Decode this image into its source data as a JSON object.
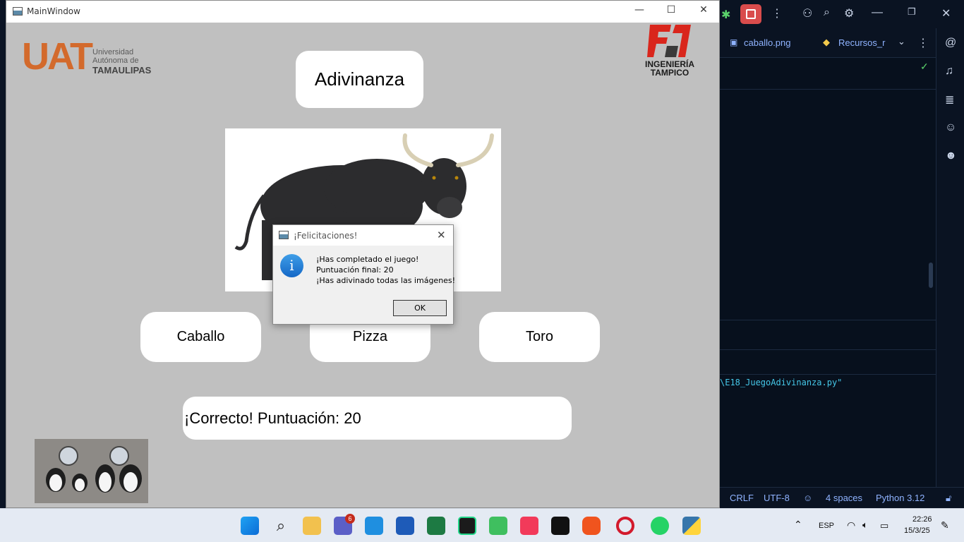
{
  "window": {
    "title": "MainWindow",
    "controls": {
      "minimize": "—",
      "maximize": "☐",
      "close": "✕"
    }
  },
  "logos": {
    "uat": {
      "mark": "UAT",
      "line1": "Universidad",
      "line2": "Autónoma de",
      "line3": "TAMAULIPAS"
    },
    "fi": {
      "line1": "INGENIERÍA",
      "line2": "TAMPICO"
    }
  },
  "game": {
    "heading": "Adivinanza",
    "image_subject": "bull-photo",
    "options": [
      "Caballo",
      "Pizza",
      "Toro"
    ],
    "result": "¡Correcto! Puntuación: 20"
  },
  "dialog": {
    "title": "¡Felicitaciones!",
    "lines": [
      "¡Has completado el juego!",
      "Puntuación final: 20",
      "¡Has adivinado todas las imágenes!"
    ],
    "ok_label": "OK",
    "close_symbol": "✕"
  },
  "ide": {
    "tabs": [
      "caballo.png",
      "Recursos_r"
    ],
    "terminal_path": "\\E18_JuegoAdivinanza.py\"",
    "status": [
      "CRLF",
      "UTF-8",
      "4 spaces",
      "Python 3.12"
    ]
  },
  "taskbar": {
    "teams_badge": "6",
    "language": "ESP",
    "time": "22:26",
    "date": "15/3/25"
  },
  "colors": {
    "window_bg": "#c0c0c0",
    "uat_orange": "#d36a2c",
    "fi_red": "#d9261c",
    "info_blue": "#1467c6"
  }
}
